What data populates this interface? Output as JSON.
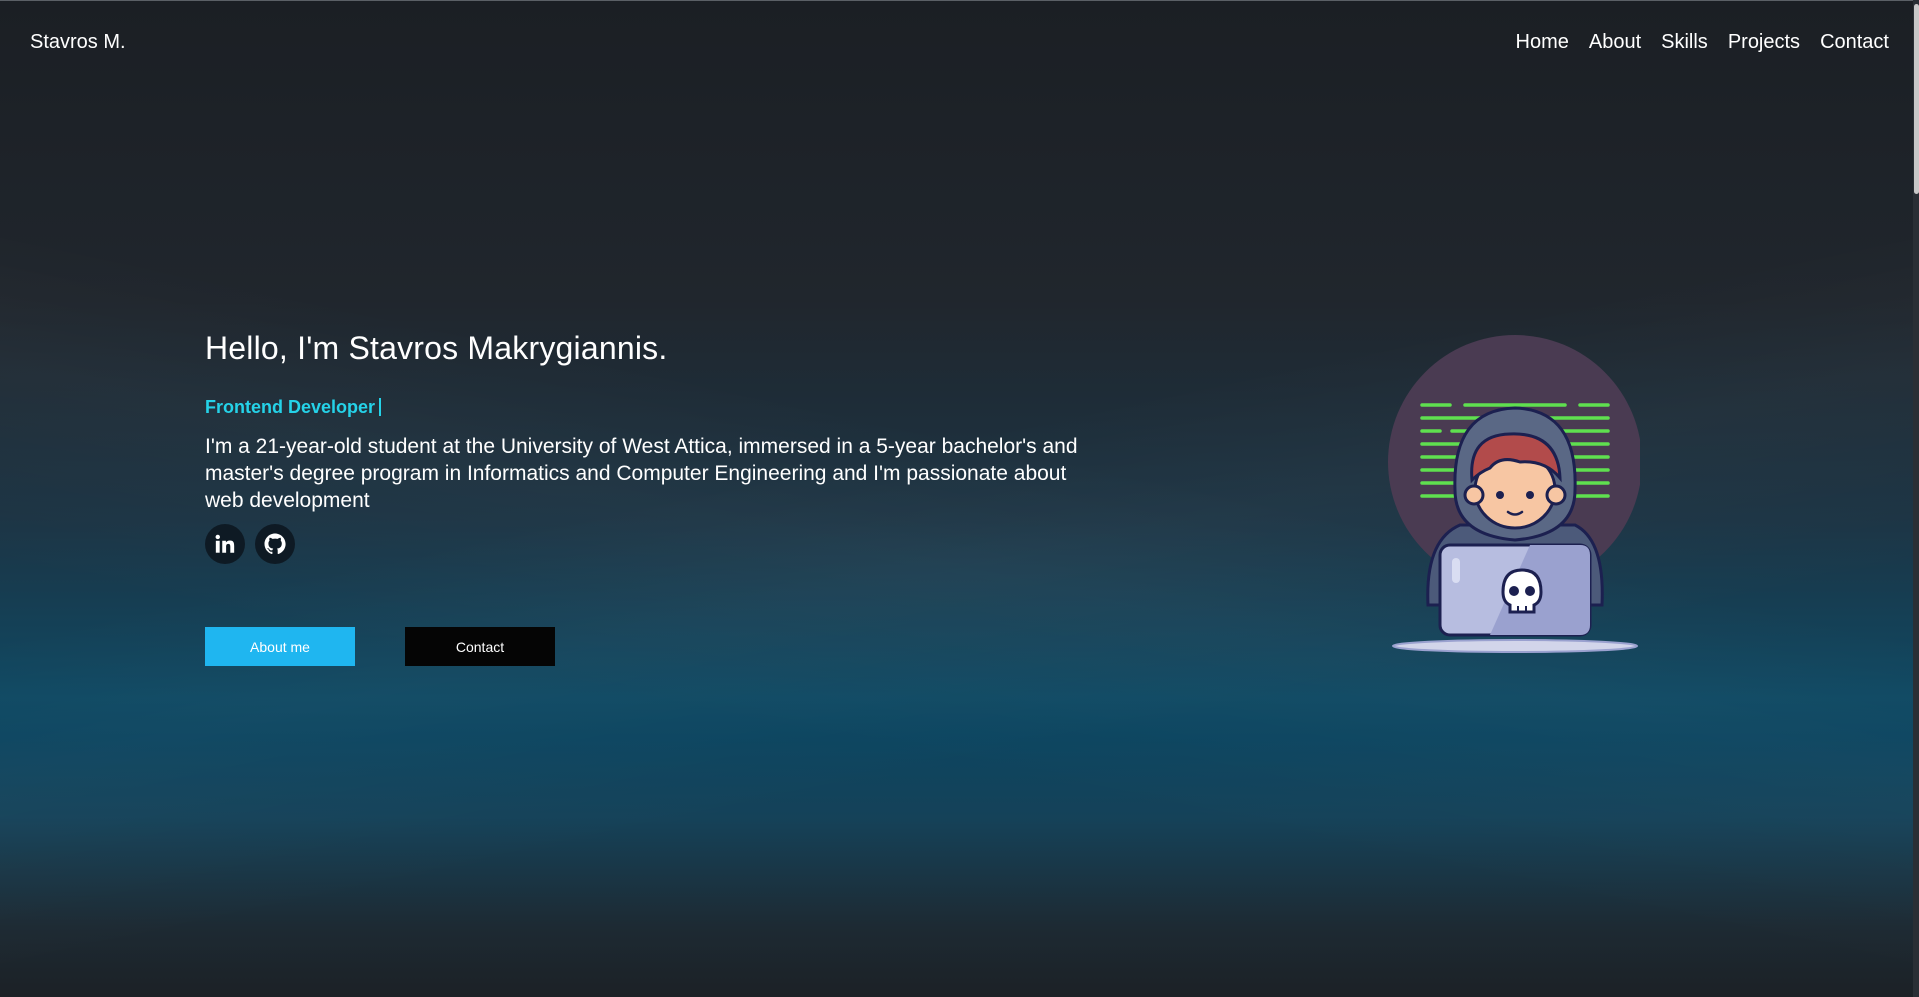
{
  "navbar": {
    "brand": "Stavros M.",
    "links": [
      "Home",
      "About",
      "Skills",
      "Projects",
      "Contact"
    ]
  },
  "hero": {
    "title": "Hello, I'm Stavros Makrygiannis.",
    "role": "Frontend Developer",
    "bio": "I'm a 21-year-old student at the University of West Attica, immersed in a 5-year bachelor's and master's degree program in Informatics and Computer Engineering and I'm passionate about web development",
    "socials": [
      "linkedin-icon",
      "github-icon"
    ],
    "buttons": {
      "about": "About me",
      "contact": "Contact"
    }
  },
  "colors": {
    "accent": "#25d2e8",
    "primary_button": "#1fb6f0",
    "dark_button": "#050505"
  }
}
